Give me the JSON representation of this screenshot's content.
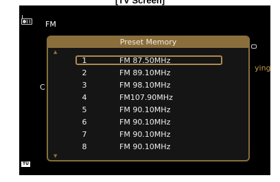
{
  "caption": "[TV Screen]",
  "source": {
    "icon": "tuner-radio-icon",
    "label": "FM"
  },
  "background": {
    "left_char": "C",
    "right_text": "ying",
    "tu_badge": "TU"
  },
  "dialog": {
    "title": "Preset Memory",
    "selected_index": 0,
    "presets": [
      {
        "number": "1",
        "frequency": "FM 87.50MHz"
      },
      {
        "number": "2",
        "frequency": "FM 89.10MHz"
      },
      {
        "number": "3",
        "frequency": "FM 98.10MHz"
      },
      {
        "number": "4",
        "frequency": "FM107.90MHz"
      },
      {
        "number": "5",
        "frequency": "FM 90.10MHz"
      },
      {
        "number": "6",
        "frequency": "FM 90.10MHz"
      },
      {
        "number": "7",
        "frequency": "FM 90.10MHz"
      },
      {
        "number": "8",
        "frequency": "FM 90.10MHz"
      }
    ]
  },
  "colors": {
    "accent": "#8a6f3d",
    "selection_border": "#b08c4f",
    "screen_bg": "#000000"
  }
}
